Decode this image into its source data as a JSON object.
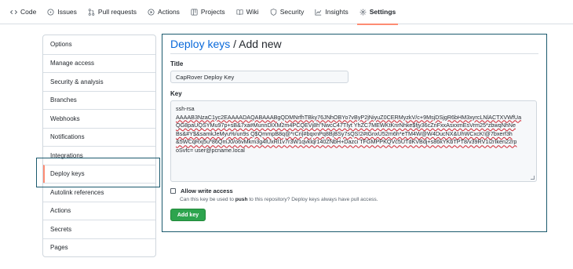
{
  "repo_nav": {
    "tabs": [
      {
        "label": "Code",
        "icon": "code-icon"
      },
      {
        "label": "Issues",
        "icon": "issue-icon"
      },
      {
        "label": "Pull requests",
        "icon": "pull-request-icon"
      },
      {
        "label": "Actions",
        "icon": "play-icon"
      },
      {
        "label": "Projects",
        "icon": "table-icon"
      },
      {
        "label": "Wiki",
        "icon": "book-icon"
      },
      {
        "label": "Security",
        "icon": "shield-icon"
      },
      {
        "label": "Insights",
        "icon": "graph-icon"
      },
      {
        "label": "Settings",
        "icon": "gear-icon"
      }
    ],
    "active_tab": "Settings",
    "active_underline_color": "#fd8c73"
  },
  "sidebar": {
    "items": [
      {
        "label": "Options"
      },
      {
        "label": "Manage access"
      },
      {
        "label": "Security & analysis"
      },
      {
        "label": "Branches"
      },
      {
        "label": "Webhooks"
      },
      {
        "label": "Notifications"
      },
      {
        "label": "Integrations"
      },
      {
        "label": "Deploy keys"
      },
      {
        "label": "Autolink references"
      },
      {
        "label": "Actions"
      },
      {
        "label": "Secrets"
      },
      {
        "label": "Pages"
      }
    ],
    "active_item": "Deploy keys"
  },
  "main": {
    "breadcrumb_link": "Deploy keys",
    "breadcrumb_separator": " / ",
    "page_title": "Add new",
    "title_field": {
      "label": "Title",
      "value": "CapRover Deploy Key"
    },
    "key_field": {
      "label": "Key",
      "lines": [
        "ssh-rsa",
        "AAAAB3NzaC1yc2EAAAADAQABAAABgQDMNrfhTBky76JNhOBYo7vByP2jNiyuZ0CERMyzkV/c+9MsjDSjgR6bHM3xyrcLNlACTXVWfUa",
        "QG8paUQSYMu97p+sB&7xa#MunnDIXM2m4PCQEVj8h\"NwcC47TIyt YhZC7MEWKtKnrNhke$fjy36cZnFxxAsxxmEsVrm25*zbwqNhNe",
        "Bs&#Y$&samkJeMyu%/un9s Q$QmmpB8q@*rCri|#bqxnPq8BjBSy7sQS!2#tGnxU52m6h*eTM4W@W4DucNX&UhWCxcK!@7bxerf3h",
        "&5WCqRxj5u*86QmJ0/o6vMkm3g4lUxRl1v7r3W1qvklqr140ZNbH+Dazci TFGMPPKQVc5UTdKVBdj+s86kYKbTPT8/v39RV1i2rIken22rp",
        "oSvfc= user@pcname.local"
      ]
    },
    "write_access": {
      "label": "Allow write access",
      "checked": false,
      "help_before": "Can this key be used to ",
      "help_bold": "push",
      "help_after": " to this repository? Deploy keys always have pull access."
    },
    "submit_label": "Add key",
    "submit_color": "#2da44e"
  },
  "annotation_box_color": "#1b5a6e"
}
